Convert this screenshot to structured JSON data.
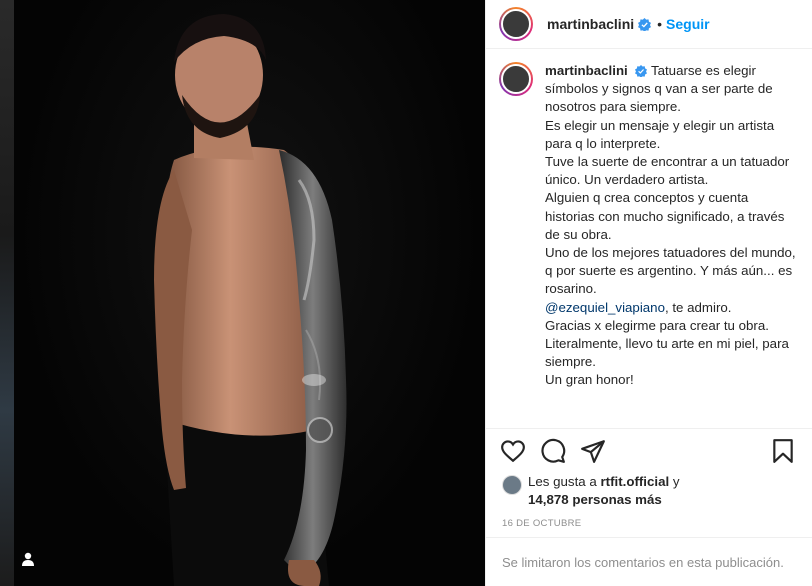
{
  "post": {
    "username": "martinbaclini",
    "separator": "•",
    "follow_label": "Seguir",
    "caption_lines": [
      "Tatuarse es elegir símbolos y signos q van a ser parte de nosotros para siempre.",
      "Es elegir un mensaje y elegir un artista para q lo interprete.",
      "Tuve la suerte de encontrar a un tatuador único. Un verdadero artista.",
      "Alguien q crea conceptos y cuenta historias con mucho significado, a través de su obra.",
      "Uno de los mejores tatuadores del mundo, q por suerte es argentino. Y más aún... es rosarino."
    ],
    "mention": "@ezequiel_viapiano",
    "mention_suffix": ", te admiro.",
    "caption_end_lines": [
      "Gracias x elegirme para crear tu obra.",
      "Literalmente, llevo tu arte en mi piel, para siempre.",
      "Un gran honor!"
    ],
    "likes_prefix": "Les gusta a",
    "likes_user": "rtfit.official",
    "likes_middle": "y",
    "likes_count": "14,878 personas más",
    "date": "16 DE OCTUBRE",
    "comments_notice": "Se limitaron los comentarios en esta publicación."
  },
  "icons": {
    "verified": "verified-badge-icon",
    "like": "heart-icon",
    "comment": "comment-bubble-icon",
    "share": "paper-plane-icon",
    "save": "bookmark-icon",
    "tag": "user-tag-icon"
  },
  "colors": {
    "follow": "#0095f6",
    "verified": "#3897f0",
    "muted": "#8e8e8e",
    "mention": "#00376b"
  }
}
